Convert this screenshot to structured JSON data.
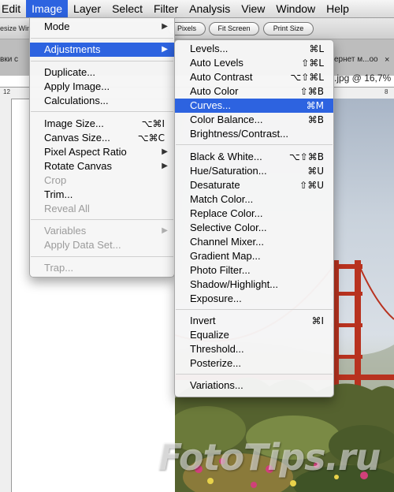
{
  "menubar": {
    "items": [
      "Edit",
      "Image",
      "Layer",
      "Select",
      "Filter",
      "Analysis",
      "View",
      "Window",
      "Help"
    ],
    "active": "Image"
  },
  "options_bar": {
    "left_text": "esize Win",
    "buttons": [
      "Pixels",
      "Fit Screen",
      "Print Size"
    ]
  },
  "doc_tabs": {
    "left_text": "вки с ",
    "right_text_top": "ернет м...оо",
    "right_text_bottom": ".jpg @ 16,7%",
    "close_glyph": "×"
  },
  "ruler": {
    "ticks": [
      "12",
      "8"
    ]
  },
  "image_menu": {
    "items": [
      {
        "label": "Mode",
        "submenu": true
      },
      {
        "label": "Adjustments",
        "submenu": true,
        "highlighted": true
      },
      {
        "label": "Duplicate..."
      },
      {
        "label": "Apply Image..."
      },
      {
        "label": "Calculations..."
      },
      {
        "label": "Image Size...",
        "shortcut": "⌥⌘I"
      },
      {
        "label": "Canvas Size...",
        "shortcut": "⌥⌘C"
      },
      {
        "label": "Pixel Aspect Ratio",
        "submenu": true
      },
      {
        "label": "Rotate Canvas",
        "submenu": true
      },
      {
        "label": "Crop",
        "disabled": true
      },
      {
        "label": "Trim..."
      },
      {
        "label": "Reveal All",
        "disabled": true
      },
      {
        "label": "Variables",
        "submenu": true,
        "disabled": true
      },
      {
        "label": "Apply Data Set...",
        "disabled": true
      },
      {
        "label": "Trap...",
        "disabled": true
      }
    ]
  },
  "adjustments_menu": {
    "items": [
      {
        "label": "Levels...",
        "shortcut": "⌘L"
      },
      {
        "label": "Auto Levels",
        "shortcut": "⇧⌘L"
      },
      {
        "label": "Auto Contrast",
        "shortcut": "⌥⇧⌘L"
      },
      {
        "label": "Auto Color",
        "shortcut": "⇧⌘B"
      },
      {
        "label": "Curves...",
        "shortcut": "⌘M",
        "highlighted": true
      },
      {
        "label": "Color Balance...",
        "shortcut": "⌘B"
      },
      {
        "label": "Brightness/Contrast..."
      },
      {
        "label": "Black & White...",
        "shortcut": "⌥⇧⌘B"
      },
      {
        "label": "Hue/Saturation...",
        "shortcut": "⌘U"
      },
      {
        "label": "Desaturate",
        "shortcut": "⇧⌘U"
      },
      {
        "label": "Match Color..."
      },
      {
        "label": "Replace Color..."
      },
      {
        "label": "Selective Color..."
      },
      {
        "label": "Channel Mixer..."
      },
      {
        "label": "Gradient Map..."
      },
      {
        "label": "Photo Filter..."
      },
      {
        "label": "Shadow/Highlight..."
      },
      {
        "label": "Exposure..."
      },
      {
        "label": "Invert",
        "shortcut": "⌘I"
      },
      {
        "label": "Equalize"
      },
      {
        "label": "Threshold..."
      },
      {
        "label": "Posterize..."
      },
      {
        "label": "Variations..."
      }
    ]
  },
  "watermark": "FotoTips.ru",
  "colors": {
    "highlight": "#2d63e0",
    "bridge": "#b8321f",
    "disabled_text": "#9b9b9b"
  }
}
